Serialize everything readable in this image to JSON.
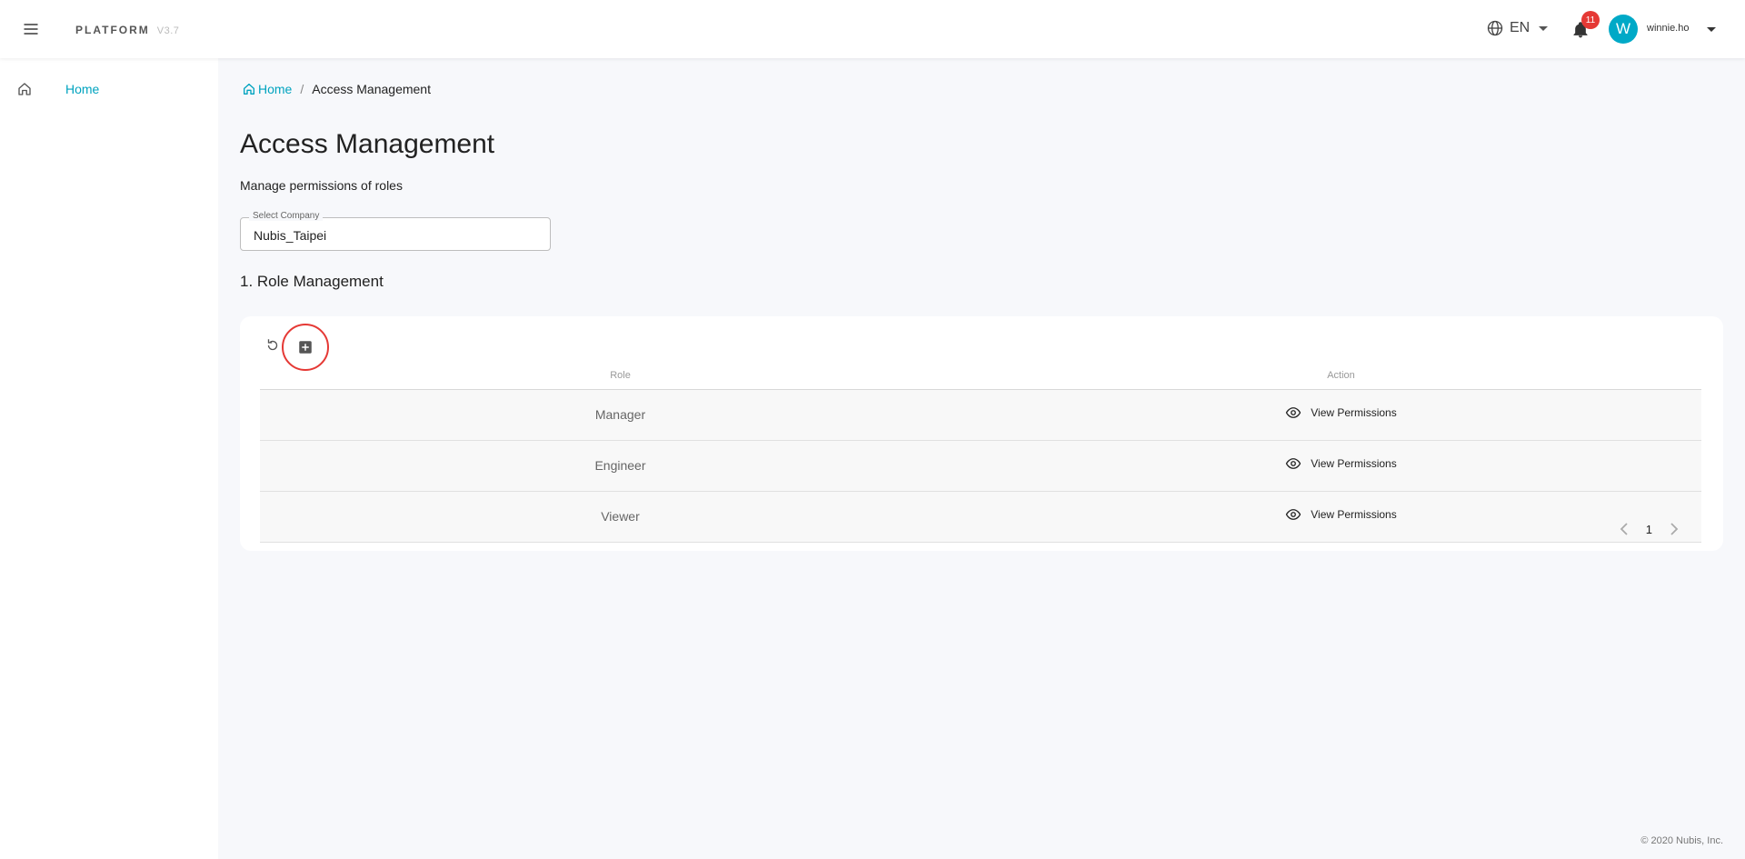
{
  "header": {
    "brand": "PLATFORM",
    "version": "V3.7",
    "language": "EN",
    "notification_count": "11",
    "avatar_initial": "W",
    "username": "winnie.ho"
  },
  "sidebar": {
    "items": [
      {
        "label": "Home",
        "icon": "home-icon"
      }
    ]
  },
  "breadcrumb": {
    "home": "Home",
    "separator": "/",
    "current": "Access Management"
  },
  "page": {
    "title": "Access Management",
    "subtitle": "Manage permissions of roles"
  },
  "company_select": {
    "label": "Select Company",
    "value": "Nubis_Taipei"
  },
  "section": {
    "title": "1. Role Management"
  },
  "table": {
    "columns": [
      "Role",
      "Action"
    ],
    "rows": [
      {
        "role": "Manager",
        "action": "View Permissions"
      },
      {
        "role": "Engineer",
        "action": "View Permissions"
      },
      {
        "role": "Viewer",
        "action": "View Permissions"
      }
    ]
  },
  "pagination": {
    "current_page": "1"
  },
  "footer": {
    "copyright": "© 2020 Nubis, Inc."
  },
  "colors": {
    "accent": "#00a3bf",
    "badge": "#e53935",
    "highlight_circle": "#e53935"
  }
}
